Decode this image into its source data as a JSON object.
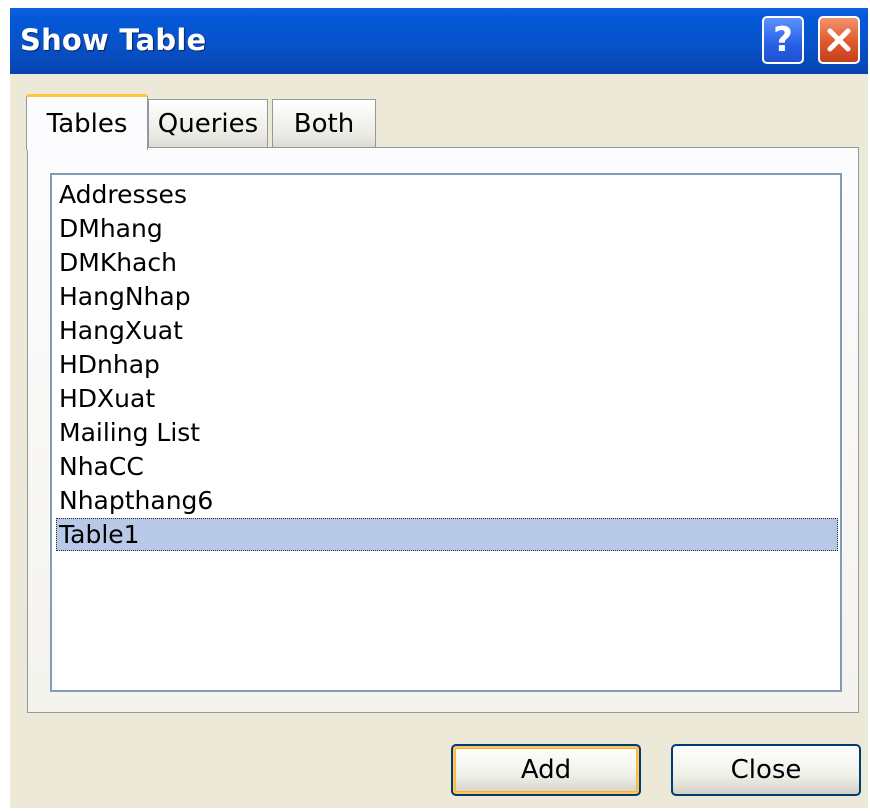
{
  "window": {
    "title": "Show Table"
  },
  "titlebar_buttons": {
    "help": "?",
    "close": "close-icon"
  },
  "tabs": [
    {
      "label": "Tables",
      "active": true
    },
    {
      "label": "Queries",
      "active": false
    },
    {
      "label": "Both",
      "active": false
    }
  ],
  "list": {
    "items": [
      {
        "label": "Addresses"
      },
      {
        "label": "DMhang"
      },
      {
        "label": "DMKhach"
      },
      {
        "label": "HangNhap"
      },
      {
        "label": "HangXuat"
      },
      {
        "label": "HDnhap"
      },
      {
        "label": "HDXuat"
      },
      {
        "label": "Mailing List"
      },
      {
        "label": "NhaCC"
      },
      {
        "label": "Nhapthang6"
      },
      {
        "label": "Table1"
      }
    ],
    "selected": "Table1"
  },
  "buttons": {
    "add": "Add",
    "close": "Close"
  },
  "colors": {
    "titlebar": "#0752c9",
    "selection": "#b8c9e8",
    "active_tab_accent": "#ffc83c"
  }
}
